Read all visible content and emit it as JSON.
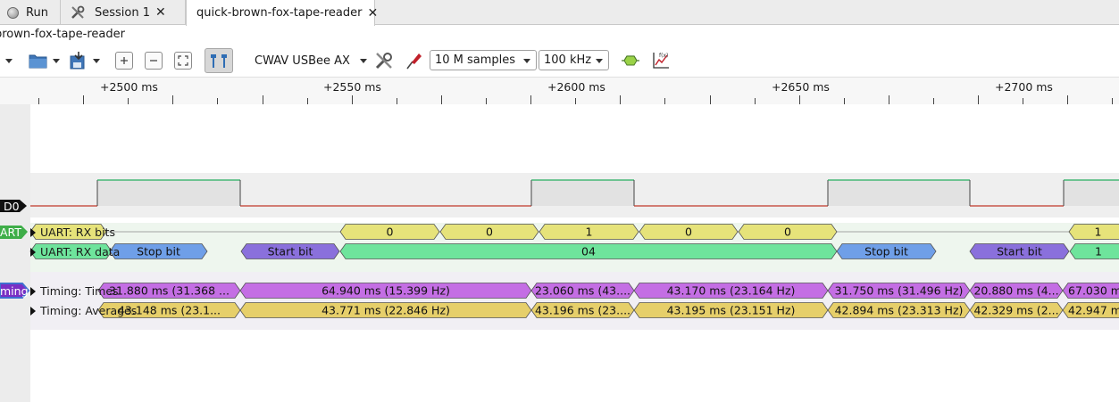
{
  "tabs": {
    "run_label": "Run",
    "session_label": "Session 1",
    "file_label": "quick-brown-fox-tape-reader"
  },
  "session_name": "brown-fox-tape-reader",
  "toolbar": {
    "device": "CWAV USBee AX",
    "samples": "10 M samples",
    "rate": "100 kHz"
  },
  "ruler": {
    "labels": [
      "+2500 ms",
      "+2550 ms",
      "+2600 ms",
      "+2650 ms",
      "+2700 ms"
    ]
  },
  "channels": {
    "d0": "D0",
    "uart_tag": "ART",
    "timing_tag": "ming"
  },
  "rows": {
    "rx_bits": "UART: RX bits",
    "rx_data": "UART: RX data",
    "times": "Timing: Times",
    "averages": "Timing: Averages"
  },
  "decode": {
    "rx_bits": [
      "0",
      "0",
      "1",
      "0",
      "0",
      "1"
    ],
    "rx_data": [
      "Stop bit",
      "Start bit",
      "04",
      "Stop bit",
      "Start bit",
      "1"
    ],
    "times": [
      "31.880 ms (31.368 ...",
      "64.940 ms (15.399 Hz)",
      "23.060 ms (43....",
      "43.170 ms (23.164 Hz)",
      "31.750 ms (31.496 Hz)",
      "20.880 ms (4...",
      "67.030 m"
    ],
    "averages": [
      "43.148 ms (23.1...",
      "43.771 ms (22.846 Hz)",
      "43.196 ms (23....",
      "43.195 ms (23.151 Hz)",
      "42.894 ms (23.313 Hz)",
      "42.329 ms (2...",
      "42.947 m"
    ]
  },
  "colors": {
    "bits": "#e6e37a",
    "stop": "#6f9fe8",
    "start": "#8a70dc",
    "data": "#6ee49c",
    "times": "#c46ee4",
    "averages": "#e6cf6a",
    "signal_low": "#c0392b",
    "signal_high": "#27ae60"
  }
}
